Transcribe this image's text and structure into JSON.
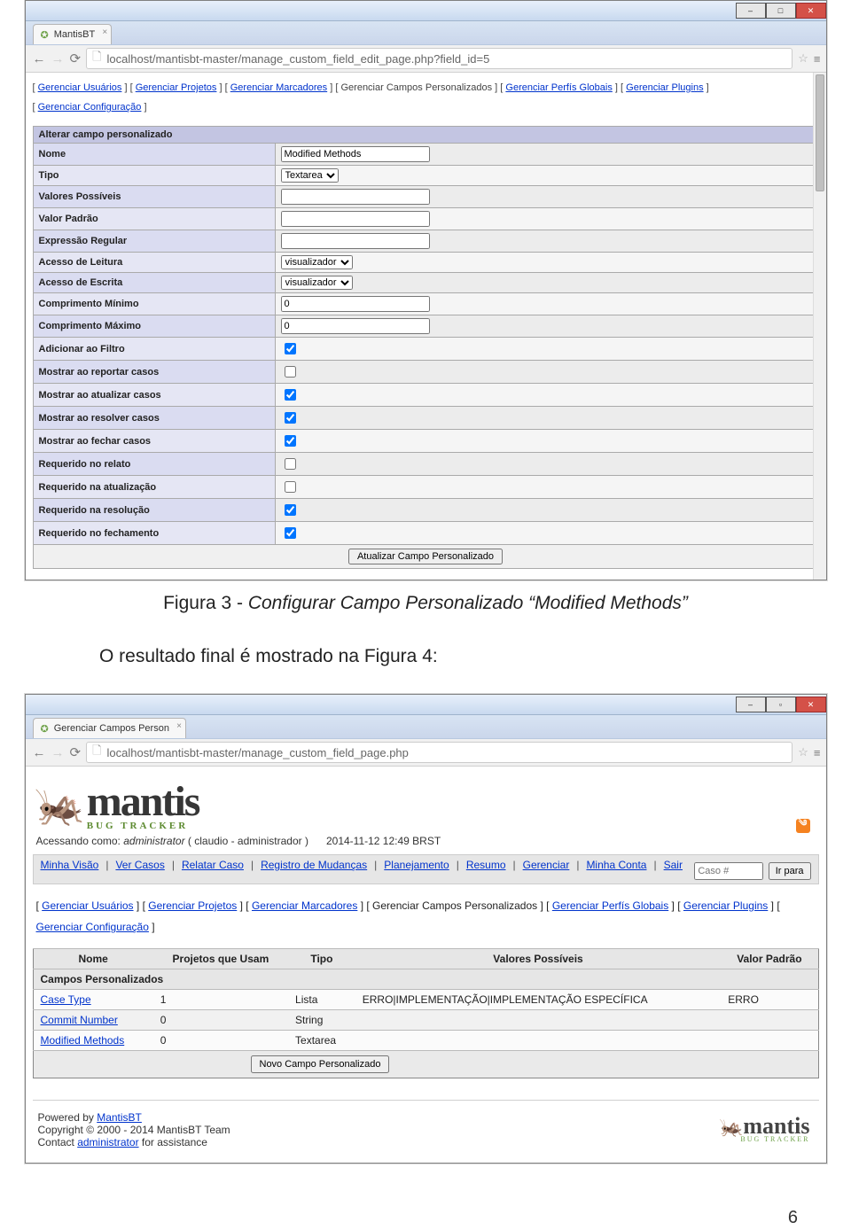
{
  "frame1": {
    "tab_title": "MantisBT",
    "url": "localhost/mantisbt-master/manage_custom_field_edit_page.php?field_id=5",
    "admin_links": [
      {
        "label": "Gerenciar Usuários",
        "current": false
      },
      {
        "label": "Gerenciar Projetos",
        "current": false
      },
      {
        "label": "Gerenciar Marcadores",
        "current": false
      },
      {
        "label": "Gerenciar Campos Personalizados",
        "current": true
      },
      {
        "label": "Gerenciar Perfís Globais",
        "current": false
      },
      {
        "label": "Gerenciar Plugins",
        "current": false
      },
      {
        "label": "Gerenciar Configuração",
        "current": false
      }
    ],
    "form_title": "Alterar campo personalizado",
    "rows": [
      {
        "label": "Nome",
        "type": "text",
        "value": "Modified Methods"
      },
      {
        "label": "Tipo",
        "type": "select",
        "value": "Textarea"
      },
      {
        "label": "Valores Possíveis",
        "type": "text",
        "value": ""
      },
      {
        "label": "Valor Padrão",
        "type": "text",
        "value": ""
      },
      {
        "label": "Expressão Regular",
        "type": "text",
        "value": ""
      },
      {
        "label": "Acesso de Leitura",
        "type": "select",
        "value": "visualizador"
      },
      {
        "label": "Acesso de Escrita",
        "type": "select",
        "value": "visualizador"
      },
      {
        "label": "Comprimento Mínimo",
        "type": "text",
        "value": "0"
      },
      {
        "label": "Comprimento Máximo",
        "type": "text",
        "value": "0"
      },
      {
        "label": "Adicionar ao Filtro",
        "type": "check",
        "value": true
      },
      {
        "label": "Mostrar ao reportar casos",
        "type": "check",
        "value": false
      },
      {
        "label": "Mostrar ao atualizar casos",
        "type": "check",
        "value": true
      },
      {
        "label": "Mostrar ao resolver casos",
        "type": "check",
        "value": true
      },
      {
        "label": "Mostrar ao fechar casos",
        "type": "check",
        "value": true
      },
      {
        "label": "Requerido no relato",
        "type": "check",
        "value": false
      },
      {
        "label": "Requerido na atualização",
        "type": "check",
        "value": false
      },
      {
        "label": "Requerido na resolução",
        "type": "check",
        "value": true
      },
      {
        "label": "Requerido no fechamento",
        "type": "check",
        "value": true
      }
    ],
    "submit_label": "Atualizar Campo Personalizado"
  },
  "caption1_prefix": "Figura 3 - ",
  "caption1_italic": "Configurar Campo Personalizado “Modified Methods”",
  "inter_text": "O resultado final é mostrado na Figura 4:",
  "frame2": {
    "tab_title": "Gerenciar Campos Person",
    "url": "localhost/mantisbt-master/manage_custom_field_page.php",
    "logo_big": "mantis",
    "logo_sub": "BUG TRACKER",
    "status_prefix": "Acessando como: ",
    "status_user": "administrator",
    "status_paren": " ( claudio - administrador )",
    "status_time": "2014-11-12 12:49 BRST",
    "nav": [
      "Minha Visão",
      "Ver Casos",
      "Relatar Caso",
      "Registro de Mudanças",
      "Planejamento",
      "Resumo",
      "Gerenciar",
      "Minha Conta",
      "Sair"
    ],
    "jump_placeholder": "Caso #",
    "jump_btn": "Ir para",
    "admin_links": [
      {
        "label": "Gerenciar Usuários",
        "current": false
      },
      {
        "label": "Gerenciar Projetos",
        "current": false
      },
      {
        "label": "Gerenciar Marcadores",
        "current": false
      },
      {
        "label": "Gerenciar Campos Personalizados",
        "current": true
      },
      {
        "label": "Gerenciar Perfís Globais",
        "current": false
      },
      {
        "label": "Gerenciar Plugins",
        "current": false
      },
      {
        "label": "Gerenciar Configuração",
        "current": false
      }
    ],
    "table_title": "Campos Personalizados",
    "columns": [
      "Nome",
      "Projetos que Usam",
      "Tipo",
      "Valores Possíveis",
      "Valor Padrão"
    ],
    "rows": [
      {
        "nome": "Case Type",
        "proj": "1",
        "tipo": "Lista",
        "vals": "ERRO|IMPLEMENTAÇÃO|IMPLEMENTAÇÃO ESPECÍFICA",
        "padrao": "ERRO"
      },
      {
        "nome": "Commit Number",
        "proj": "0",
        "tipo": "String",
        "vals": "",
        "padrao": ""
      },
      {
        "nome": "Modified Methods",
        "proj": "0",
        "tipo": "Textarea",
        "vals": "",
        "padrao": ""
      }
    ],
    "new_btn": "Novo Campo Personalizado",
    "footer_powered": "Powered by ",
    "footer_mantis": "MantisBT",
    "footer_copy": "Copyright © 2000 - 2014 MantisBT Team",
    "footer_contact_pre": "Contact ",
    "footer_contact_link": "administrator",
    "footer_contact_post": " for assistance"
  },
  "page_number": "6"
}
